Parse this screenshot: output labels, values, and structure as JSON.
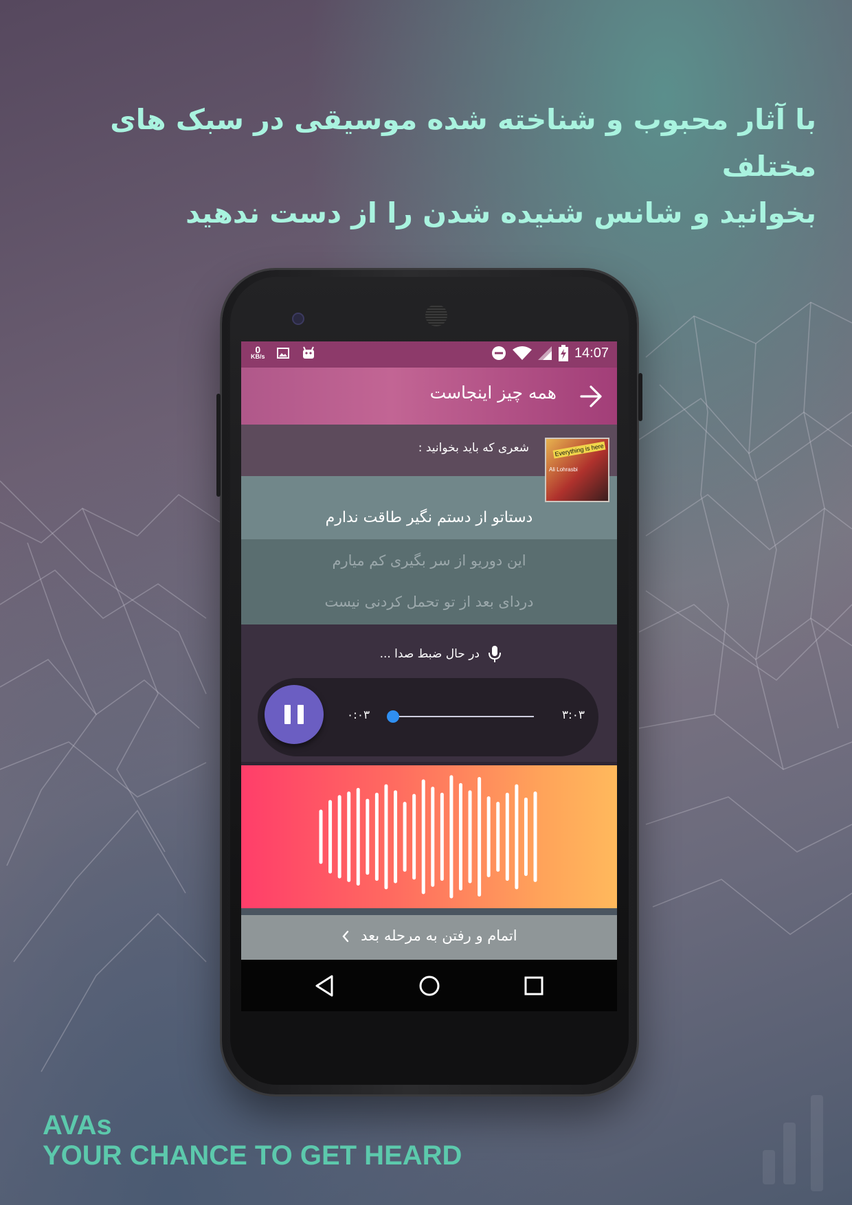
{
  "headline": {
    "line1": "با آثار محبوب و شناخته شده موسیقی در سبک های مختلف",
    "line2": "بخوانید و شانس شنیده شدن را از دست ندهید"
  },
  "brand": {
    "name": "AVAs",
    "tagline": "YOUR CHANCE TO GET HEARD"
  },
  "status_bar": {
    "net_speed_value": "0",
    "net_speed_unit": "KB/s",
    "time": "14:07"
  },
  "app_bar": {
    "title": "همه چیز اینجاست"
  },
  "song": {
    "label": "شعری که باید بخوانید :",
    "album_art_text": "Everything is here",
    "album_art_artist": "Ali Lohrasbi"
  },
  "lyrics": [
    "دستاتو از دستم نگیر طاقت ندارم",
    "این دوریو از سر بگیری کم میارم",
    "دردای بعد از تو تحمل کردنی نیست"
  ],
  "recorder": {
    "status": "در حال ضبط صدا ...",
    "current_time": "۰:۰۳",
    "total_time": "۳:۰۳",
    "progress": 0.0
  },
  "next_button": {
    "label": "اتمام و رفتن به مرحله بعد"
  },
  "waveform": {
    "bar_heights": [
      0.42,
      0.58,
      0.66,
      0.72,
      0.78,
      0.6,
      0.7,
      0.84,
      0.74,
      0.55,
      0.68,
      0.92,
      0.8,
      0.7,
      0.99,
      0.86,
      0.74,
      0.96,
      0.64,
      0.55,
      0.7,
      0.84,
      0.62,
      0.72
    ]
  },
  "colors": {
    "headline": "#a9f3df",
    "brand": "#5cc9ac",
    "status_bar": "#8d3a6a",
    "app_bar": "#b0588a",
    "pause_button": "#6b5ec2",
    "progress_thumb": "#2f8ff2",
    "wave_gradient_start": "#ff3e6a",
    "wave_gradient_end": "#ffb95c"
  }
}
